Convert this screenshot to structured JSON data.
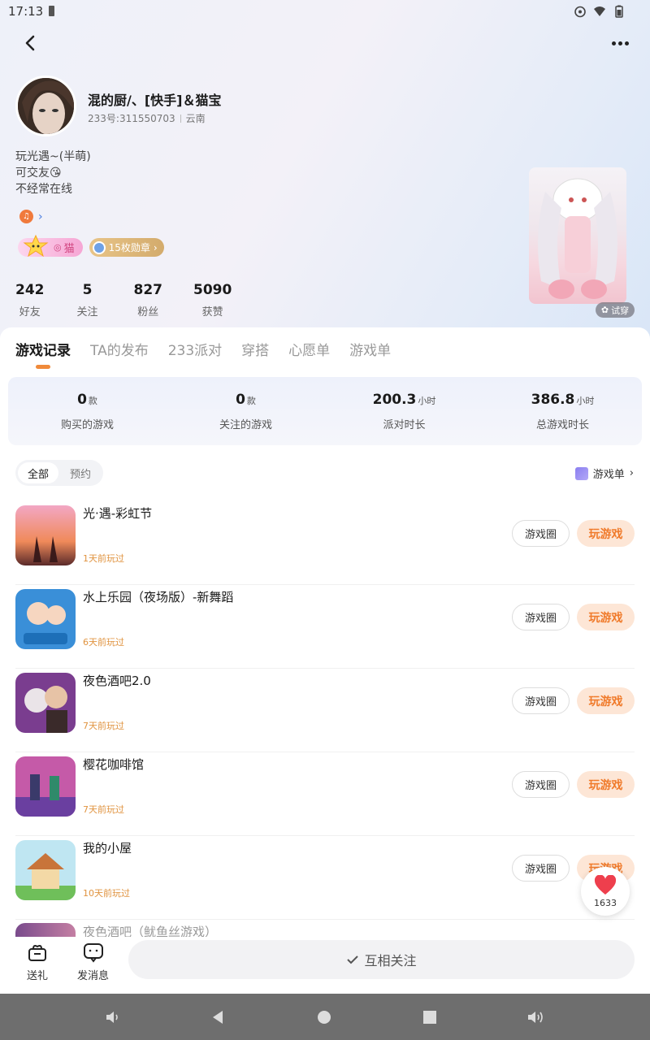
{
  "status_bar": {
    "time": "17:13"
  },
  "profile": {
    "username": "混的厨/、[快手]＆猫宝",
    "id_text": "233号:311550703",
    "location": "云南",
    "bio": [
      "玩光遇~(半萌)",
      "可交友😘",
      "不经常在线"
    ],
    "badges": {
      "cat_label": "猫",
      "medal_label": "15枚勋章"
    },
    "stats": [
      {
        "value": "242",
        "label": "好友"
      },
      {
        "value": "5",
        "label": "关注"
      },
      {
        "value": "827",
        "label": "粉丝"
      },
      {
        "value": "5090",
        "label": "获赞"
      }
    ],
    "try_on_label": "试穿"
  },
  "tabs": [
    "游戏记录",
    "TA的发布",
    "233派对",
    "穿搭",
    "心愿单",
    "游戏单"
  ],
  "summary": [
    {
      "value": "0",
      "unit": "款",
      "label": "购买的游戏"
    },
    {
      "value": "0",
      "unit": "款",
      "label": "关注的游戏"
    },
    {
      "value": "200.3",
      "unit": "小时",
      "label": "派对时长"
    },
    {
      "value": "386.8",
      "unit": "小时",
      "label": "总游戏时长"
    }
  ],
  "filter": {
    "all": "全部",
    "reserve": "预约",
    "gamelist": "游戏单"
  },
  "games": [
    {
      "name": "光·遇-彩虹节",
      "last_played": "1天前玩过",
      "circle": "游戏圈",
      "play": "玩游戏"
    },
    {
      "name": "水上乐园（夜场版）-新舞蹈",
      "last_played": "6天前玩过",
      "circle": "游戏圈",
      "play": "玩游戏"
    },
    {
      "name": "夜色酒吧2.0",
      "last_played": "7天前玩过",
      "circle": "游戏圈",
      "play": "玩游戏"
    },
    {
      "name": "樱花咖啡馆",
      "last_played": "7天前玩过",
      "circle": "游戏圈",
      "play": "玩游戏"
    },
    {
      "name": "我的小屋",
      "last_played": "10天前玩过",
      "circle": "游戏圈",
      "play": "玩游戏"
    }
  ],
  "partial_game": "夜色酒吧（鱿鱼丝游戏）",
  "like_count": "1633",
  "bottom_bar": {
    "gift": "送礼",
    "message": "发消息",
    "mutual": "互相关注"
  },
  "colors": {
    "accent": "#f07a2a",
    "play_bg": "#fde6d6",
    "time_text": "#e0933f"
  }
}
